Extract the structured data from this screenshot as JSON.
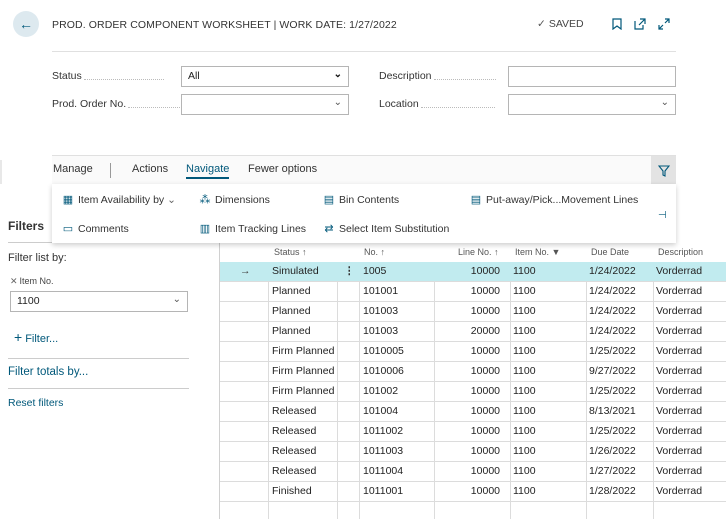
{
  "header": {
    "title": "PROD. ORDER COMPONENT WORKSHEET | WORK DATE: 1/27/2022",
    "saved": "SAVED",
    "back_glyph": "←"
  },
  "fields": {
    "status_label": "Status",
    "status_value": "All",
    "prod_order_label": "Prod. Order No.",
    "prod_order_value": "",
    "description_label": "Description",
    "description_value": "",
    "location_label": "Location",
    "location_value": ""
  },
  "actions": {
    "manage": "Manage",
    "actions": "Actions",
    "navigate": "Navigate",
    "fewer": "Fewer options"
  },
  "navigate_menu": {
    "item_availability": "Item Availability by",
    "dimensions": "Dimensions",
    "bin_contents": "Bin Contents",
    "putaway": "Put-away/Pick...Movement Lines",
    "comments": "Comments",
    "item_tracking": "Item Tracking Lines",
    "select_substitution": "Select Item Substitution"
  },
  "filters": {
    "title": "Filters",
    "filter_list_by": "Filter list by:",
    "item_no_label": "Item No.",
    "item_no_value": "1100",
    "add_filter": "Filter...",
    "filter_totals": "Filter totals by...",
    "reset": "Reset filters"
  },
  "grid": {
    "columns": [
      "Status ↑",
      "No. ↑",
      "Line No. ↑",
      "Item No.",
      "Due Date",
      "Description"
    ],
    "rows": [
      {
        "status": "Simulated",
        "no": "1005",
        "line": "10000",
        "item": "1100",
        "due": "1/24/2022",
        "desc": "Vorderrad"
      },
      {
        "status": "Planned",
        "no": "101001",
        "line": "10000",
        "item": "1100",
        "due": "1/24/2022",
        "desc": "Vorderrad"
      },
      {
        "status": "Planned",
        "no": "101003",
        "line": "10000",
        "item": "1100",
        "due": "1/24/2022",
        "desc": "Vorderrad"
      },
      {
        "status": "Planned",
        "no": "101003",
        "line": "20000",
        "item": "1100",
        "due": "1/24/2022",
        "desc": "Vorderrad"
      },
      {
        "status": "Firm Planned",
        "no": "1010005",
        "line": "10000",
        "item": "1100",
        "due": "1/25/2022",
        "desc": "Vorderrad"
      },
      {
        "status": "Firm Planned",
        "no": "1010006",
        "line": "10000",
        "item": "1100",
        "due": "9/27/2022",
        "desc": "Vorderrad"
      },
      {
        "status": "Firm Planned",
        "no": "101002",
        "line": "10000",
        "item": "1100",
        "due": "1/25/2022",
        "desc": "Vorderrad"
      },
      {
        "status": "Released",
        "no": "101004",
        "line": "10000",
        "item": "1100",
        "due": "8/13/2021",
        "desc": "Vorderrad"
      },
      {
        "status": "Released",
        "no": "1011002",
        "line": "10000",
        "item": "1100",
        "due": "1/25/2022",
        "desc": "Vorderrad"
      },
      {
        "status": "Released",
        "no": "1011003",
        "line": "10000",
        "item": "1100",
        "due": "1/26/2022",
        "desc": "Vorderrad"
      },
      {
        "status": "Released",
        "no": "1011004",
        "line": "10000",
        "item": "1100",
        "due": "1/27/2022",
        "desc": "Vorderrad"
      },
      {
        "status": "Finished",
        "no": "1011001",
        "line": "10000",
        "item": "1100",
        "due": "1/28/2022",
        "desc": "Vorderrad"
      }
    ]
  }
}
